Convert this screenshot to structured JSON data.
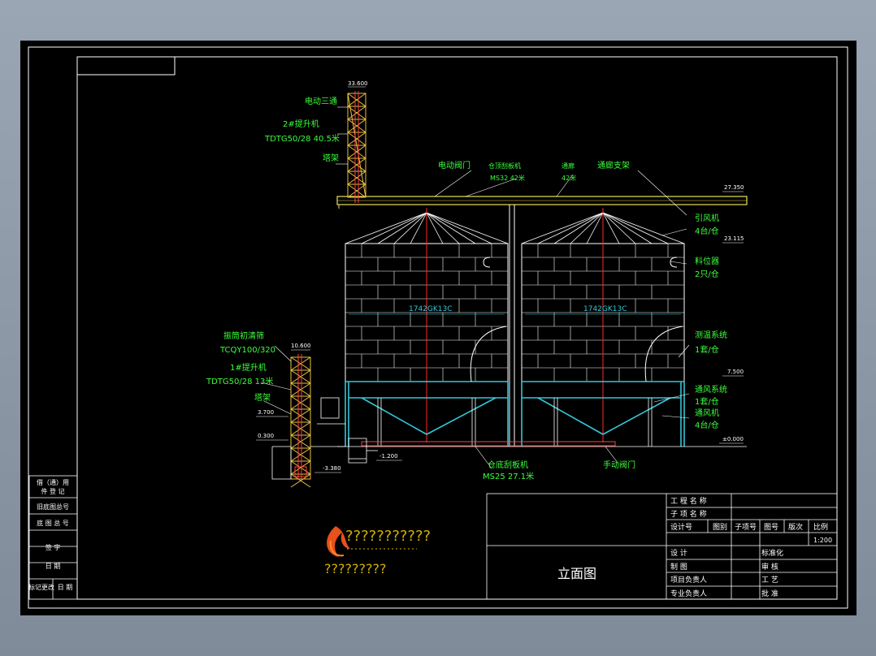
{
  "drawing": {
    "title": "立面图",
    "elevations": {
      "e1": "33.600",
      "e2": "27.350",
      "e3": "23.115",
      "e4": "7.500",
      "e5": "±0.000",
      "e6": "10.600",
      "e7": "3.700",
      "e8": "0.300",
      "e9": "-1.200",
      "e10": "-3.380"
    },
    "annotations": {
      "a1": "电动三通",
      "a2": "2#提升机",
      "a3": "TDTG50/28 40.5米",
      "a4": "塔架",
      "a5": "电动阀门",
      "a6": "仓顶刮板机",
      "a7": "MS32 42米",
      "a8": "通廊",
      "a9": "42米",
      "a10": "通廊支架",
      "a11": "引风机",
      "a12": "4台/仓",
      "a13": "料位器",
      "a14": "2只/仓",
      "a15": "测温系统",
      "a16": "1套/仓",
      "a17": "通风系统",
      "a18": "1套/仓",
      "a19": "通风机",
      "a20": "4台/仓",
      "a21": "振筒初清筛",
      "a22": "TCQY100/320",
      "a23": "1#提升机",
      "a24": "TDTG50/28 13米",
      "a25": "塔架",
      "a26": "仓底刮板机",
      "a27": "MS25 27.1米",
      "a28": "手动阀门",
      "silo_left": "1742GK13C",
      "silo_right": "1742GK13C"
    },
    "logo_text": "???????????",
    "logo_sub": "?????????",
    "left_strip": {
      "r1a": "借（通）用",
      "r1b": "件 登 记",
      "r2": "旧底图总号",
      "r3": "底 图 总 号",
      "r4": "签 字",
      "r5": "日 期",
      "r6a": "标记更改",
      "r6b": "日 期"
    },
    "title_block": {
      "project_name": "工 程 名 称",
      "sub_item_name": "子 项 名 称",
      "h_design_no": "设计号",
      "h_category": "图别",
      "h_sub_no": "子项号",
      "h_drawing_no": "图号",
      "h_version": "版次",
      "h_scale": "比例",
      "scale_value": "1:200",
      "design": "设 计",
      "standardize": "标准化",
      "draw": "制 图",
      "review": "审 核",
      "project_lead": "项目负责人",
      "process": "工 艺",
      "discipline_lead": "专业负责人",
      "approve": "批 准"
    }
  }
}
